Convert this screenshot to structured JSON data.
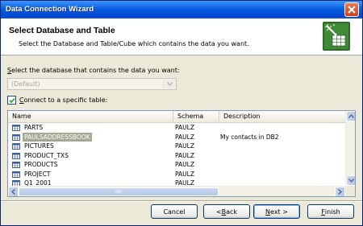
{
  "window": {
    "title": "Data Connection Wizard"
  },
  "header": {
    "title": "Select Database and Table",
    "subtitle": "Select the Database and Table/Cube which contains the data you want."
  },
  "database": {
    "label_accel": "S",
    "label_rest": "elect the database that contains the data you want:",
    "value": "(Default)"
  },
  "connect": {
    "checked": true,
    "label_accel": "C",
    "label_rest": "onnect to a specific table:"
  },
  "table": {
    "columns": [
      "Name",
      "Schema",
      "Description"
    ],
    "rows": [
      {
        "name": "PARTS",
        "schema": "PAULZ",
        "description": ""
      },
      {
        "name": "PAULSADDRESSBOOK",
        "schema": "PAULZ",
        "description": "My contacts in DB2",
        "selected": true
      },
      {
        "name": "PICTURES",
        "schema": "PAULZ",
        "description": ""
      },
      {
        "name": "PRODUCT_TXS",
        "schema": "PAULZ",
        "description": ""
      },
      {
        "name": "PRODUCTS",
        "schema": "PAULZ",
        "description": ""
      },
      {
        "name": "PROJECT",
        "schema": "PAULZ",
        "description": ""
      },
      {
        "name": "Q1_2001",
        "schema": "PAULZ",
        "description": ""
      }
    ]
  },
  "buttons": {
    "cancel": "Cancel",
    "back_prefix": "< ",
    "back_accel": "B",
    "back_rest": "ack",
    "next_accel": "N",
    "next_rest": "ext >",
    "finish_accel": "F",
    "finish_rest": "inish"
  },
  "icons": {
    "close": "close-icon",
    "wizard": "database-wizard-icon",
    "table": "table-icon",
    "dropdown": "chevron-down-icon",
    "check": "check-icon",
    "scroll_up": "arrow-up-icon",
    "scroll_down": "arrow-down-icon",
    "scroll_left": "arrow-left-icon",
    "scroll_right": "arrow-right-icon",
    "grip": "grip-icon"
  },
  "colors": {
    "titlebar": "#0a5fe0",
    "close": "#c8431c",
    "selection": "#a7a894",
    "wizard_icon": "#2e6b2a"
  }
}
